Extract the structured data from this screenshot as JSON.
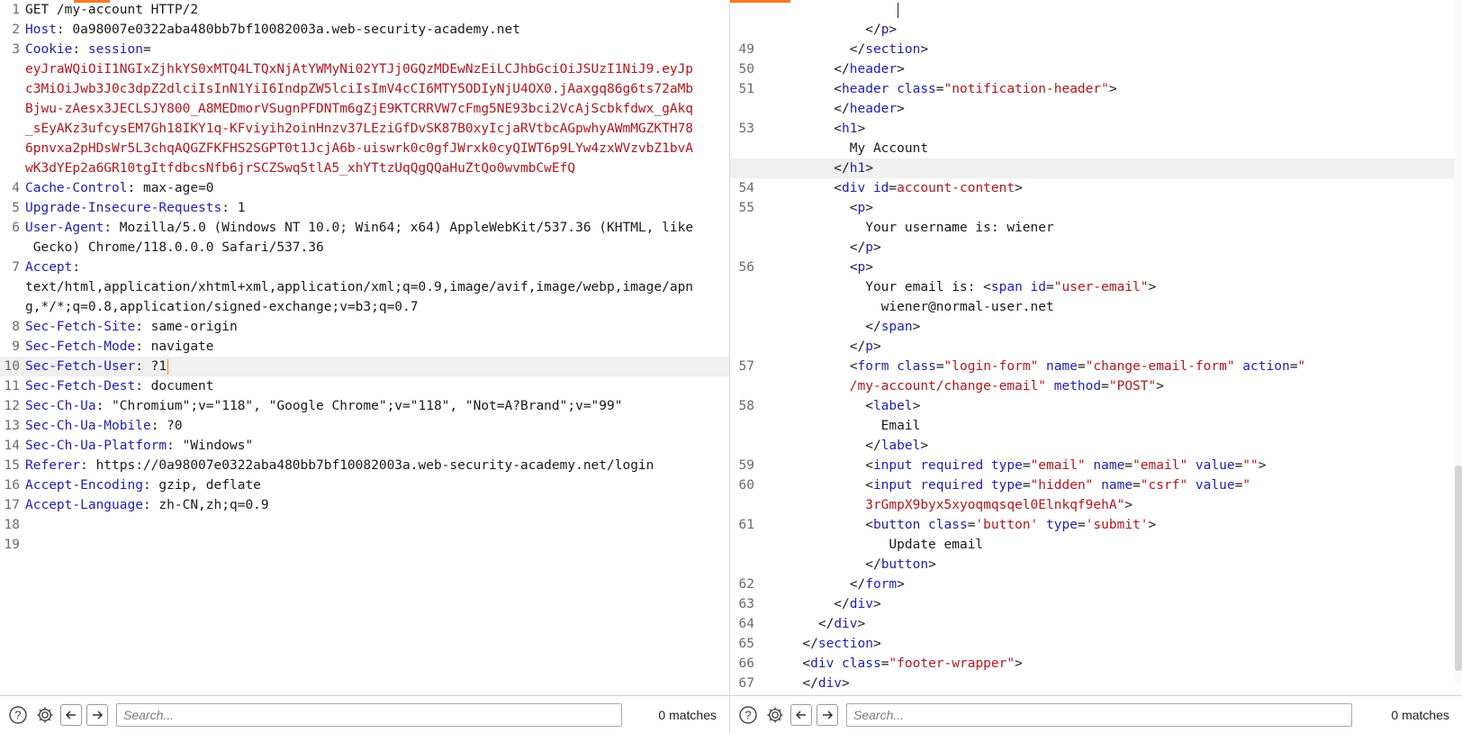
{
  "request": {
    "lines": [
      {
        "n": "1",
        "parts": [
          {
            "c": "t",
            "s": "GET /my-account HTTP/2"
          }
        ]
      },
      {
        "n": "2",
        "parts": [
          {
            "c": "k",
            "s": "Host"
          },
          {
            "c": "t",
            "s": ": 0a98007e0322aba480bb7bf10082003a.web-security-academy.net"
          }
        ]
      },
      {
        "n": "3",
        "parts": [
          {
            "c": "k",
            "s": "Cookie"
          },
          {
            "c": "t",
            "s": ": "
          },
          {
            "c": "k",
            "s": "session"
          },
          {
            "c": "t",
            "s": "="
          }
        ]
      },
      {
        "n": "",
        "parts": [
          {
            "c": "r",
            "s": "eyJraWQiOiI1NGIxZjhkYS0xMTQ4LTQxNjAtYWMyNi02YTJj0GQzMDEwNzEiLCJhbGciOiJSUzI1NiJ9.eyJp"
          }
        ]
      },
      {
        "n": "",
        "parts": [
          {
            "c": "r",
            "s": "c3MiOiJwb3J0c3dpZ2dlciIsInN1YiI6IndpZW5lciIsImV4cCI6MTY5ODIyNjU4OX0.jAaxgq86g6ts72aMb"
          }
        ]
      },
      {
        "n": "",
        "parts": [
          {
            "c": "r",
            "s": "Bjwu-zAesx3JECLSJY800_A8MEDmorVSugnPFDNTm6gZjE9KTCRRVW7cFmg5NE93bci2VcAjScbkfdwx_gAkq"
          }
        ]
      },
      {
        "n": "",
        "parts": [
          {
            "c": "r",
            "s": "_sEyAKz3ufcysEM7Gh18IKY1q-KFviyih2oinHnzv37LEziGfDvSK87B0xyIcjaRVtbcAGpwhyAWmMGZKTH78"
          }
        ]
      },
      {
        "n": "",
        "parts": [
          {
            "c": "r",
            "s": "6pnvxa2pHDsWr5L3chqAQGZFKFHS2SGPT0t1JcjA6b-uiswrk0c0gfJWrxk0cyQIWT6p9LYw4zxWVzvbZ1bvA"
          }
        ]
      },
      {
        "n": "",
        "parts": [
          {
            "c": "r",
            "s": "wK3dYEp2a6GR10tgItfdbcsNfb6jrSCZSwq5tlA5_xhYTtzUqQgQQaHuZtQo0wvmbCwEfQ"
          }
        ]
      },
      {
        "n": "4",
        "parts": [
          {
            "c": "k",
            "s": "Cache-Control"
          },
          {
            "c": "t",
            "s": ": max-age=0"
          }
        ]
      },
      {
        "n": "5",
        "parts": [
          {
            "c": "k",
            "s": "Upgrade-Insecure-Requests"
          },
          {
            "c": "t",
            "s": ": 1"
          }
        ]
      },
      {
        "n": "6",
        "parts": [
          {
            "c": "k",
            "s": "User-Agent"
          },
          {
            "c": "t",
            "s": ": Mozilla/5.0 (Windows NT 10.0; Win64; x64) AppleWebKit/537.36 (KHTML, like"
          }
        ]
      },
      {
        "n": "",
        "parts": [
          {
            "c": "t",
            "s": " Gecko) Chrome/118.0.0.0 Safari/537.36"
          }
        ]
      },
      {
        "n": "7",
        "parts": [
          {
            "c": "k",
            "s": "Accept"
          },
          {
            "c": "t",
            "s": ":"
          }
        ]
      },
      {
        "n": "",
        "parts": [
          {
            "c": "t",
            "s": "text/html,application/xhtml+xml,application/xml;q=0.9,image/avif,image/webp,image/apn"
          }
        ]
      },
      {
        "n": "",
        "parts": [
          {
            "c": "t",
            "s": "g,*/*;q=0.8,application/signed-exchange;v=b3;q=0.7"
          }
        ]
      },
      {
        "n": "8",
        "parts": [
          {
            "c": "k",
            "s": "Sec-Fetch-Site"
          },
          {
            "c": "t",
            "s": ": same-origin"
          }
        ]
      },
      {
        "n": "9",
        "parts": [
          {
            "c": "k",
            "s": "Sec-Fetch-Mode"
          },
          {
            "c": "t",
            "s": ": navigate"
          }
        ]
      },
      {
        "n": "10",
        "hl": true,
        "caret": true,
        "parts": [
          {
            "c": "k",
            "s": "Sec-Fetch-User"
          },
          {
            "c": "t",
            "s": ": ?1"
          }
        ]
      },
      {
        "n": "11",
        "parts": [
          {
            "c": "k",
            "s": "Sec-Fetch-Dest"
          },
          {
            "c": "t",
            "s": ": document"
          }
        ]
      },
      {
        "n": "12",
        "parts": [
          {
            "c": "k",
            "s": "Sec-Ch-Ua"
          },
          {
            "c": "t",
            "s": ": \"Chromium\";v=\"118\", \"Google Chrome\";v=\"118\", \"Not=A?Brand\";v=\"99\""
          }
        ]
      },
      {
        "n": "13",
        "parts": [
          {
            "c": "k",
            "s": "Sec-Ch-Ua-Mobile"
          },
          {
            "c": "t",
            "s": ": ?0"
          }
        ]
      },
      {
        "n": "14",
        "parts": [
          {
            "c": "k",
            "s": "Sec-Ch-Ua-Platform"
          },
          {
            "c": "t",
            "s": ": \"Windows\""
          }
        ]
      },
      {
        "n": "15",
        "parts": [
          {
            "c": "k",
            "s": "Referer"
          },
          {
            "c": "t",
            "s": ": https://0a98007e0322aba480bb7bf10082003a.web-security-academy.net/login"
          }
        ]
      },
      {
        "n": "16",
        "parts": [
          {
            "c": "k",
            "s": "Accept-Encoding"
          },
          {
            "c": "t",
            "s": ": gzip, deflate"
          }
        ]
      },
      {
        "n": "17",
        "parts": [
          {
            "c": "k",
            "s": "Accept-Language"
          },
          {
            "c": "t",
            "s": ": zh-CN,zh;q=0.9"
          }
        ]
      },
      {
        "n": "18",
        "parts": []
      },
      {
        "n": "19",
        "parts": []
      }
    ],
    "search_placeholder": "Search...",
    "matches": "0 matches"
  },
  "response": {
    "lines": [
      {
        "n": "",
        "caret": true,
        "parts": [
          {
            "c": "t",
            "s": "                  "
          }
        ]
      },
      {
        "n": "",
        "parts": [
          {
            "c": "t",
            "s": "              </"
          },
          {
            "c": "k",
            "s": "p"
          },
          {
            "c": "t",
            "s": ">"
          }
        ]
      },
      {
        "n": "49",
        "parts": [
          {
            "c": "t",
            "s": "            </"
          },
          {
            "c": "k",
            "s": "section"
          },
          {
            "c": "t",
            "s": ">"
          }
        ]
      },
      {
        "n": "50",
        "parts": [
          {
            "c": "t",
            "s": "          </"
          },
          {
            "c": "k",
            "s": "header"
          },
          {
            "c": "t",
            "s": ">"
          }
        ]
      },
      {
        "n": "51",
        "parts": [
          {
            "c": "t",
            "s": "          <"
          },
          {
            "c": "k",
            "s": "header class"
          },
          {
            "c": "t",
            "s": "="
          },
          {
            "c": "r",
            "s": "\"notification-header\""
          },
          {
            "c": "t",
            "s": ">"
          }
        ]
      },
      {
        "n": "",
        "parts": [
          {
            "c": "t",
            "s": "          </"
          },
          {
            "c": "k",
            "s": "header"
          },
          {
            "c": "t",
            "s": ">"
          }
        ]
      },
      {
        "n": "53",
        "parts": [
          {
            "c": "t",
            "s": "          <"
          },
          {
            "c": "k",
            "s": "h1"
          },
          {
            "c": "t",
            "s": ">"
          }
        ]
      },
      {
        "n": "",
        "parts": [
          {
            "c": "t",
            "s": "            My Account"
          }
        ]
      },
      {
        "n": "",
        "hl": true,
        "parts": [
          {
            "c": "t",
            "s": "          </"
          },
          {
            "c": "k",
            "s": "h1"
          },
          {
            "c": "t",
            "s": ">"
          }
        ]
      },
      {
        "n": "54",
        "parts": [
          {
            "c": "t",
            "s": "          <"
          },
          {
            "c": "k",
            "s": "div id"
          },
          {
            "c": "t",
            "s": "="
          },
          {
            "c": "r",
            "s": "account-content"
          },
          {
            "c": "t",
            "s": ">"
          }
        ]
      },
      {
        "n": "55",
        "parts": [
          {
            "c": "t",
            "s": "            <"
          },
          {
            "c": "k",
            "s": "p"
          },
          {
            "c": "t",
            "s": ">"
          }
        ]
      },
      {
        "n": "",
        "parts": [
          {
            "c": "t",
            "s": "              Your username is: wiener"
          }
        ]
      },
      {
        "n": "",
        "parts": [
          {
            "c": "t",
            "s": "            </"
          },
          {
            "c": "k",
            "s": "p"
          },
          {
            "c": "t",
            "s": ">"
          }
        ]
      },
      {
        "n": "56",
        "parts": [
          {
            "c": "t",
            "s": "            <"
          },
          {
            "c": "k",
            "s": "p"
          },
          {
            "c": "t",
            "s": ">"
          }
        ]
      },
      {
        "n": "",
        "parts": [
          {
            "c": "t",
            "s": "              Your email is: <"
          },
          {
            "c": "k",
            "s": "span id"
          },
          {
            "c": "t",
            "s": "="
          },
          {
            "c": "r",
            "s": "\"user-email\""
          },
          {
            "c": "t",
            "s": ">"
          }
        ]
      },
      {
        "n": "",
        "parts": [
          {
            "c": "t",
            "s": "                wiener@normal-user.net"
          }
        ]
      },
      {
        "n": "",
        "parts": [
          {
            "c": "t",
            "s": "              </"
          },
          {
            "c": "k",
            "s": "span"
          },
          {
            "c": "t",
            "s": ">"
          }
        ]
      },
      {
        "n": "",
        "parts": [
          {
            "c": "t",
            "s": "            </"
          },
          {
            "c": "k",
            "s": "p"
          },
          {
            "c": "t",
            "s": ">"
          }
        ]
      },
      {
        "n": "57",
        "parts": [
          {
            "c": "t",
            "s": "            <"
          },
          {
            "c": "k",
            "s": "form class"
          },
          {
            "c": "t",
            "s": "="
          },
          {
            "c": "r",
            "s": "\"login-form\""
          },
          {
            "c": "k",
            "s": " name"
          },
          {
            "c": "t",
            "s": "="
          },
          {
            "c": "r",
            "s": "\"change-email-form\""
          },
          {
            "c": "k",
            "s": " action"
          },
          {
            "c": "t",
            "s": "="
          },
          {
            "c": "r",
            "s": "\""
          }
        ]
      },
      {
        "n": "",
        "parts": [
          {
            "c": "r",
            "s": "            /my-account/change-email\""
          },
          {
            "c": "k",
            "s": " method"
          },
          {
            "c": "t",
            "s": "="
          },
          {
            "c": "r",
            "s": "\"POST\""
          },
          {
            "c": "t",
            "s": ">"
          }
        ]
      },
      {
        "n": "58",
        "parts": [
          {
            "c": "t",
            "s": "              <"
          },
          {
            "c": "k",
            "s": "label"
          },
          {
            "c": "t",
            "s": ">"
          }
        ]
      },
      {
        "n": "",
        "parts": [
          {
            "c": "t",
            "s": "                Email"
          }
        ]
      },
      {
        "n": "",
        "parts": [
          {
            "c": "t",
            "s": "              </"
          },
          {
            "c": "k",
            "s": "label"
          },
          {
            "c": "t",
            "s": ">"
          }
        ]
      },
      {
        "n": "59",
        "parts": [
          {
            "c": "t",
            "s": "              <"
          },
          {
            "c": "k",
            "s": "input required type"
          },
          {
            "c": "t",
            "s": "="
          },
          {
            "c": "r",
            "s": "\"email\""
          },
          {
            "c": "k",
            "s": " name"
          },
          {
            "c": "t",
            "s": "="
          },
          {
            "c": "r",
            "s": "\"email\""
          },
          {
            "c": "k",
            "s": " value"
          },
          {
            "c": "t",
            "s": "="
          },
          {
            "c": "r",
            "s": "\"\""
          },
          {
            "c": "t",
            "s": ">"
          }
        ]
      },
      {
        "n": "60",
        "parts": [
          {
            "c": "t",
            "s": "              <"
          },
          {
            "c": "k",
            "s": "input required type"
          },
          {
            "c": "t",
            "s": "="
          },
          {
            "c": "r",
            "s": "\"hidden\""
          },
          {
            "c": "k",
            "s": " name"
          },
          {
            "c": "t",
            "s": "="
          },
          {
            "c": "r",
            "s": "\"csrf\""
          },
          {
            "c": "k",
            "s": " value"
          },
          {
            "c": "t",
            "s": "="
          },
          {
            "c": "r",
            "s": "\""
          }
        ]
      },
      {
        "n": "",
        "parts": [
          {
            "c": "r",
            "s": "              3rGmpX9byx5xyoqmqsqel0Elnkqf9ehA\""
          },
          {
            "c": "t",
            "s": ">"
          }
        ]
      },
      {
        "n": "61",
        "parts": [
          {
            "c": "t",
            "s": "              <"
          },
          {
            "c": "k",
            "s": "button class"
          },
          {
            "c": "t",
            "s": "="
          },
          {
            "c": "r",
            "s": "'button'"
          },
          {
            "c": "k",
            "s": " type"
          },
          {
            "c": "t",
            "s": "="
          },
          {
            "c": "r",
            "s": "'submit'"
          },
          {
            "c": "t",
            "s": ">"
          }
        ]
      },
      {
        "n": "",
        "parts": [
          {
            "c": "t",
            "s": "                 Update email"
          }
        ]
      },
      {
        "n": "",
        "parts": [
          {
            "c": "t",
            "s": "              </"
          },
          {
            "c": "k",
            "s": "button"
          },
          {
            "c": "t",
            "s": ">"
          }
        ]
      },
      {
        "n": "62",
        "parts": [
          {
            "c": "t",
            "s": "            </"
          },
          {
            "c": "k",
            "s": "form"
          },
          {
            "c": "t",
            "s": ">"
          }
        ]
      },
      {
        "n": "63",
        "parts": [
          {
            "c": "t",
            "s": "          </"
          },
          {
            "c": "k",
            "s": "div"
          },
          {
            "c": "t",
            "s": ">"
          }
        ]
      },
      {
        "n": "64",
        "parts": [
          {
            "c": "t",
            "s": "        </"
          },
          {
            "c": "k",
            "s": "div"
          },
          {
            "c": "t",
            "s": ">"
          }
        ]
      },
      {
        "n": "65",
        "parts": [
          {
            "c": "t",
            "s": "      </"
          },
          {
            "c": "k",
            "s": "section"
          },
          {
            "c": "t",
            "s": ">"
          }
        ]
      },
      {
        "n": "66",
        "parts": [
          {
            "c": "t",
            "s": "      <"
          },
          {
            "c": "k",
            "s": "div class"
          },
          {
            "c": "t",
            "s": "="
          },
          {
            "c": "r",
            "s": "\"footer-wrapper\""
          },
          {
            "c": "t",
            "s": ">"
          }
        ]
      },
      {
        "n": "67",
        "parts": [
          {
            "c": "t",
            "s": "      </"
          },
          {
            "c": "k",
            "s": "div"
          },
          {
            "c": "t",
            "s": ">"
          }
        ]
      }
    ],
    "search_placeholder": "Search...",
    "matches": "0 matches"
  },
  "colors": {
    "accent": "#f27b27",
    "header_name": "#1f1faf",
    "value": "#b0171d"
  },
  "icons": {
    "help": "help-icon",
    "settings": "gear-icon",
    "back": "arrow-left-icon",
    "forward": "arrow-right-icon"
  }
}
